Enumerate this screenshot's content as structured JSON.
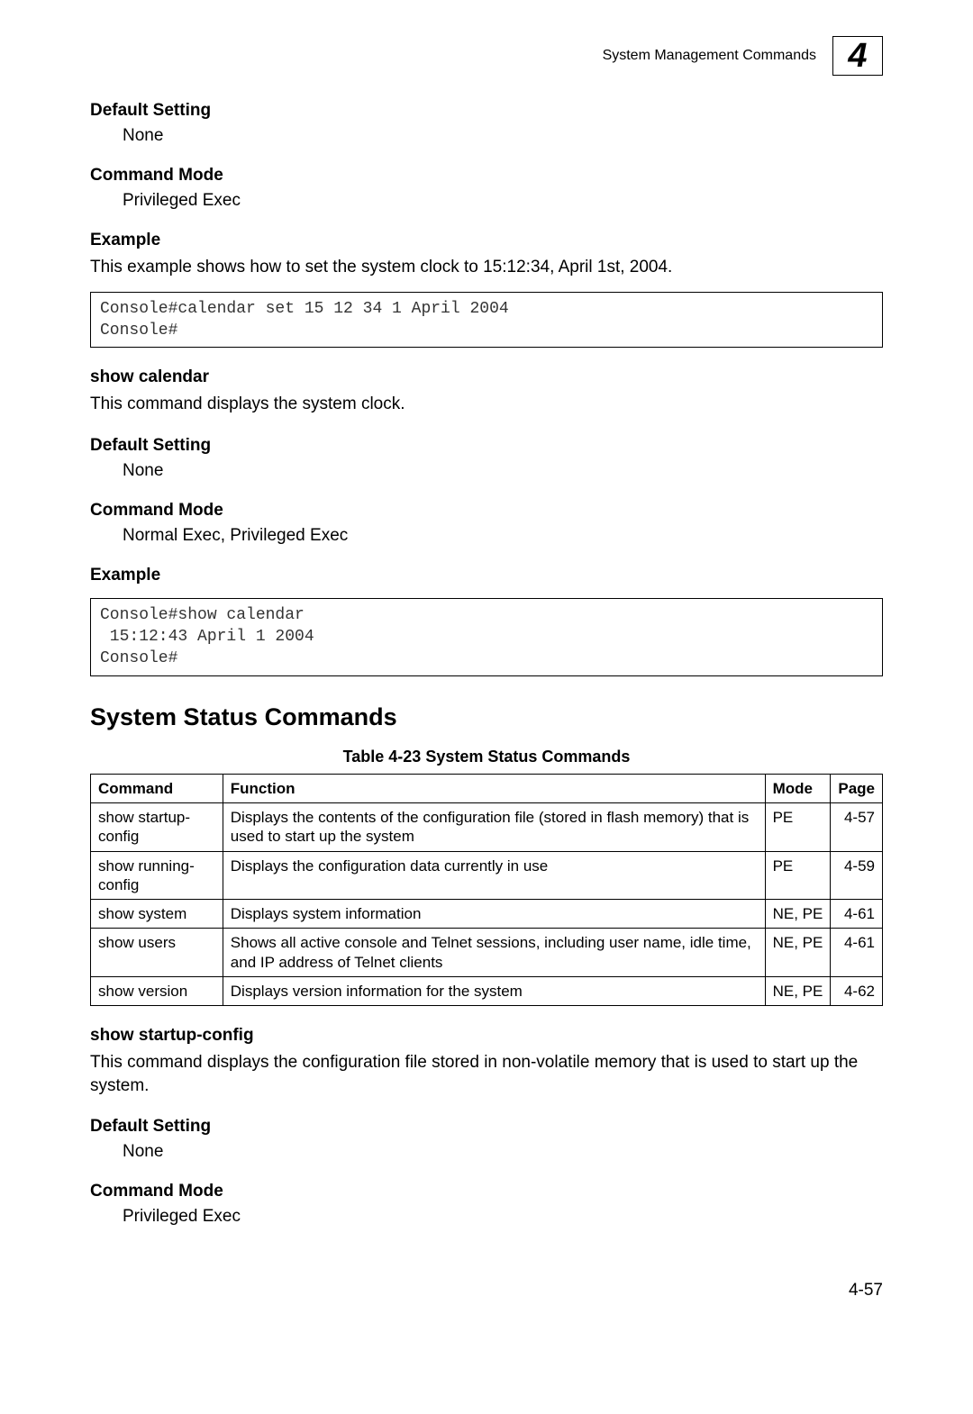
{
  "header": {
    "title": "System Management Commands",
    "chapter_number": "4"
  },
  "sections": {
    "default_setting_1": {
      "heading": "Default Setting",
      "value": "None"
    },
    "command_mode_1": {
      "heading": "Command Mode",
      "value": "Privileged Exec"
    },
    "example_1": {
      "heading": "Example",
      "intro": "This example shows how to set the system clock to 15:12:34, April 1st, 2004.",
      "code": "Console#calendar set 15 12 34 1 April 2004\nConsole#"
    },
    "show_calendar": {
      "heading": "show calendar",
      "desc": "This command displays the system clock."
    },
    "default_setting_2": {
      "heading": "Default Setting",
      "value": "None"
    },
    "command_mode_2": {
      "heading": "Command Mode",
      "value": "Normal Exec, Privileged Exec"
    },
    "example_2": {
      "heading": "Example",
      "code": "Console#show calendar\n 15:12:43 April 1 2004\nConsole#"
    },
    "status_heading": "System Status Commands",
    "table_caption": "Table 4-23  System Status Commands",
    "table": {
      "headers": {
        "c0": "Command",
        "c1": "Function",
        "c2": "Mode",
        "c3": "Page"
      },
      "rows": [
        {
          "cmd": "show startup-config",
          "fn": "Displays the contents of the configuration file (stored in flash memory) that is used to start up the system",
          "mode": "PE",
          "page": "4-57"
        },
        {
          "cmd": "show running-config",
          "fn": "Displays the configuration data currently in use",
          "mode": "PE",
          "page": "4-59"
        },
        {
          "cmd": "show system",
          "fn": "Displays system information",
          "mode": "NE, PE",
          "page": "4-61"
        },
        {
          "cmd": "show users",
          "fn": "Shows all active console and Telnet sessions, including user name, idle time, and IP address of Telnet clients",
          "mode": "NE, PE",
          "page": "4-61"
        },
        {
          "cmd": "show version",
          "fn": "Displays version information for the system",
          "mode": "NE, PE",
          "page": "4-62"
        }
      ]
    },
    "show_startup": {
      "heading": "show startup-config",
      "desc": "This command displays the configuration file stored in non-volatile memory that is used to start up the system."
    },
    "default_setting_3": {
      "heading": "Default Setting",
      "value": "None"
    },
    "command_mode_3": {
      "heading": "Command Mode",
      "value": "Privileged Exec"
    }
  },
  "page_number": "4-57"
}
